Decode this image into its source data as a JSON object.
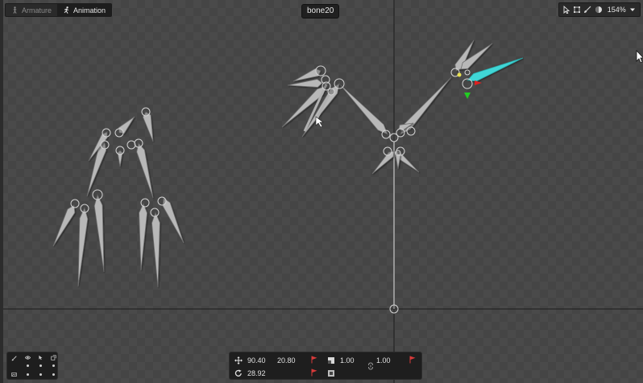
{
  "tabs": [
    {
      "label": "Armature",
      "active": false
    },
    {
      "label": "Animation",
      "active": true
    }
  ],
  "selected_bone": "bone20",
  "view_toolbar": {
    "tools": [
      "select-arrow-icon",
      "bounding-box-icon",
      "brush-icon",
      "color-sphere-icon"
    ],
    "zoom_label": "154%"
  },
  "transform": {
    "position_x": "90.40",
    "position_y": "20.80",
    "rotation": "28.92",
    "scale_x": "1.00",
    "scale_y": "1.00"
  },
  "colors": {
    "selected_bone": "#3fd6d6",
    "bone_fill": "#b8b8b8",
    "bone_stroke": "#6e6e6e",
    "axis_x": "#e02020",
    "axis_y": "#22cc22",
    "key_flag": "#d83a3a",
    "pivot": "#e8e050"
  }
}
